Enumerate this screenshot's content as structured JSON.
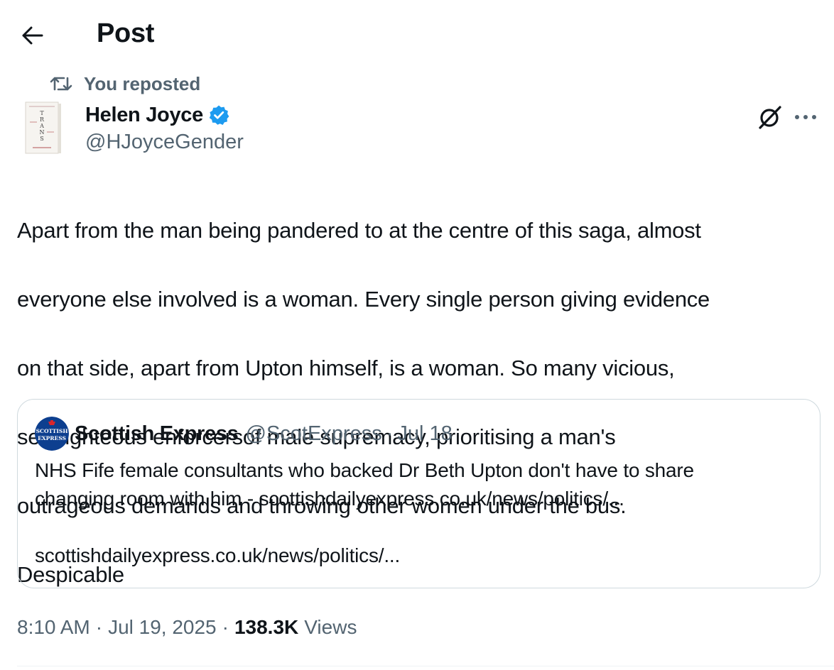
{
  "colors": {
    "text_primary": "#0f1419",
    "text_secondary": "#536471",
    "verified_blue": "#1d9bf0",
    "border": "#cfd9de"
  },
  "header": {
    "title": "Post",
    "back_icon": "arrow-left-icon"
  },
  "repost": {
    "label": "You reposted",
    "icon": "repost-icon"
  },
  "author": {
    "name": "Helen Joyce",
    "handle": "@HJoyceGender",
    "avatar_text": "TRANS",
    "verified": true
  },
  "actions": {
    "grok_icon": "grok-icon",
    "more_icon": "more-dots-icon"
  },
  "post": {
    "text_lines": [
      "Apart from the man being pandered to at the centre of this saga, almost",
      "everyone else involved is a woman. Every single person giving evidence",
      "on that side, apart from Upton himself, is a woman. So many vicious,",
      "self-righteous enforcersof male supremacy, prioritising a man's",
      "outrageous demands and throwing other women under the bus.",
      "Despicable"
    ]
  },
  "quote": {
    "avatar_text_top": "SCOTTISH",
    "avatar_text_bottom": "EXPRESS",
    "name": "Scottish Express",
    "handle": "@ScotExpress",
    "separator": "·",
    "date": "Jul 18",
    "text_lines": [
      "NHS Fife female consultants who backed Dr Beth Upton don't have to share",
      "changing room with him - scottishdailyexpress.co.uk/news/politics/..."
    ],
    "link": "scottishdailyexpress.co.uk/news/politics/..."
  },
  "meta": {
    "time": "8:10 AM",
    "separator": "·",
    "date": "Jul 19, 2025",
    "views_count": "138.3K",
    "views_label": "Views"
  }
}
